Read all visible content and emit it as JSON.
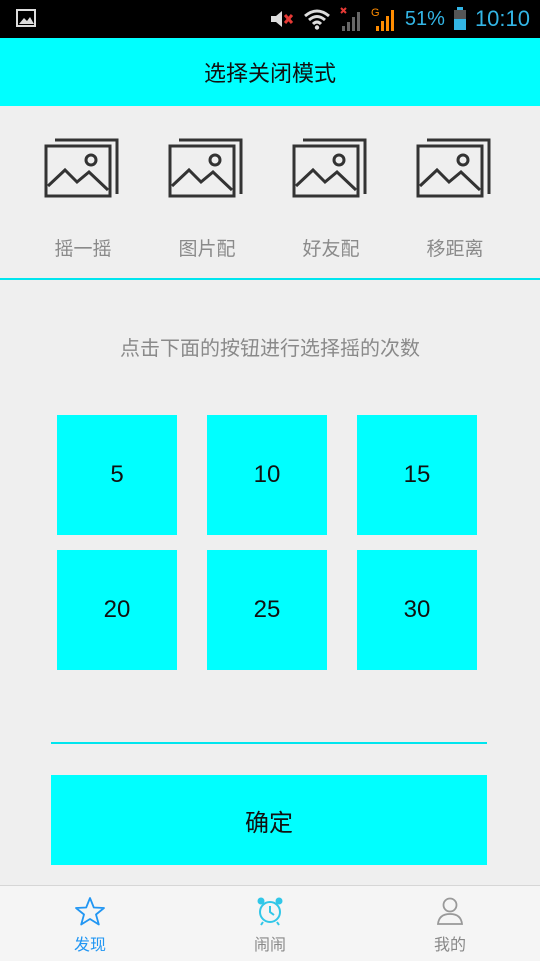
{
  "status_bar": {
    "battery_percent": "51%",
    "time": "10:10",
    "color": "#33b5e5",
    "icons": [
      "gallery-notification-icon",
      "mute-icon",
      "wifi-icon",
      "no-signal-icon",
      "mobile-signal-icon",
      "battery-icon"
    ]
  },
  "header": {
    "title": "选择关闭模式",
    "bg_color": "#00ffff"
  },
  "modes": [
    {
      "label": "摇一摇",
      "icon": "image-placeholder-icon"
    },
    {
      "label": "图片配",
      "icon": "image-placeholder-icon"
    },
    {
      "label": "好友配",
      "icon": "image-placeholder-icon"
    },
    {
      "label": "移距离",
      "icon": "image-placeholder-icon"
    }
  ],
  "hint": "点击下面的按钮进行选择摇的次数",
  "counts": [
    "5",
    "10",
    "15",
    "20",
    "25",
    "30"
  ],
  "confirm_label": "确定",
  "tabs": [
    {
      "label": "发现",
      "icon": "star-icon",
      "active": true
    },
    {
      "label": "闹闹",
      "icon": "alarm-clock-icon",
      "active": false
    },
    {
      "label": "我的",
      "icon": "person-icon",
      "active": false
    }
  ],
  "colors": {
    "accent": "#00ffff",
    "active_tab": "#2196f3",
    "inactive_tab": "#888888"
  }
}
